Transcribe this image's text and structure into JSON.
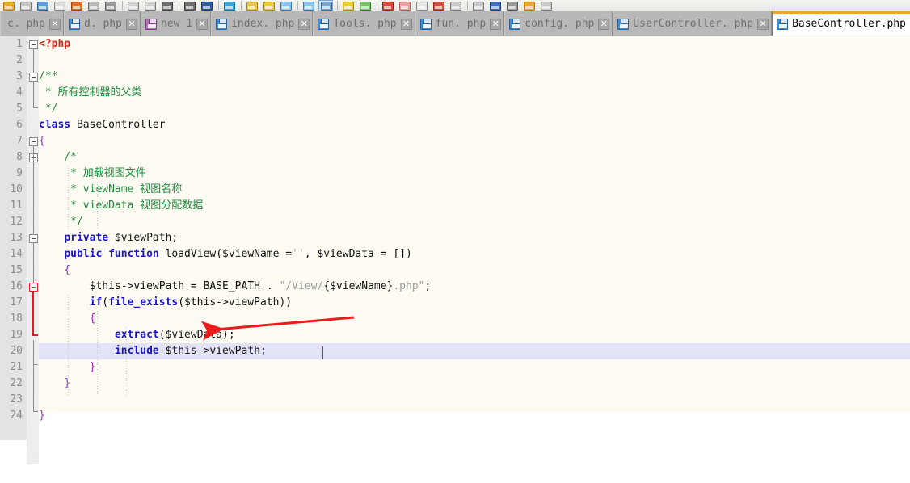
{
  "window": {
    "app": "code-editor",
    "active_file": "BaseController.php"
  },
  "toolbar": {
    "icons": [
      "open-folder-icon",
      "save-icon",
      "save-all-icon",
      "print-preview-icon",
      "close-icon",
      "print-icon",
      "cut-icon",
      "copy-icon",
      "paste-icon",
      "undo-icon",
      "redo-icon",
      "find-icon",
      "replace-icon",
      "zoom-in-icon",
      "zoom-out-icon",
      "bookmark-icon",
      "bookmark-next-icon",
      "indent-icon",
      "wrap-icon",
      "format-icon",
      "tag-icon",
      "map-icon",
      "brush-icon",
      "stop-icon",
      "browser-icon",
      "record-icon",
      "panel-icon",
      "f-icon",
      "ftp-icon",
      "window-icon"
    ]
  },
  "tabs": [
    {
      "label": "c. php",
      "icon": "floppy-icon",
      "state": "saved",
      "active": false,
      "truncated": true
    },
    {
      "label": "d. php",
      "icon": "floppy-icon",
      "state": "saved",
      "active": false,
      "truncated": false
    },
    {
      "label": "new 1",
      "icon": "floppy-unsaved-icon",
      "state": "unsaved",
      "active": false,
      "truncated": false
    },
    {
      "label": "index. php",
      "icon": "floppy-icon",
      "state": "saved",
      "active": false,
      "truncated": false
    },
    {
      "label": "Tools. php",
      "icon": "floppy-icon",
      "state": "saved",
      "active": false,
      "truncated": false
    },
    {
      "label": "fun. php",
      "icon": "floppy-icon",
      "state": "saved",
      "active": false,
      "truncated": false
    },
    {
      "label": "config. php",
      "icon": "floppy-icon",
      "state": "saved",
      "active": false,
      "truncated": false
    },
    {
      "label": "UserController. php",
      "icon": "floppy-icon",
      "state": "saved",
      "active": false,
      "truncated": false
    },
    {
      "label": "BaseController.php",
      "icon": "floppy-icon",
      "state": "saved",
      "active": true,
      "truncated": false
    }
  ],
  "tab_close_label": "✕",
  "editor": {
    "language": "php",
    "current_line": 20,
    "caret_after_text": "viewPath",
    "total_lines": 24,
    "lines": [
      {
        "n": "1",
        "text": "<?php"
      },
      {
        "n": "2",
        "text": ""
      },
      {
        "n": "3",
        "text": "/**"
      },
      {
        "n": "4",
        "text": " * 所有控制器的父类"
      },
      {
        "n": "5",
        "text": " */"
      },
      {
        "n": "6",
        "text": "class BaseController"
      },
      {
        "n": "7",
        "text": "{"
      },
      {
        "n": "8",
        "text": "    /*"
      },
      {
        "n": "9",
        "text": "     * 加载视图文件"
      },
      {
        "n": "10",
        "text": "     * viewName 视图名称"
      },
      {
        "n": "11",
        "text": "     * viewData 视图分配数据"
      },
      {
        "n": "12",
        "text": "     */"
      },
      {
        "n": "13",
        "text": "    private $viewPath;"
      },
      {
        "n": "14",
        "text": "    public function loadView($viewName ='', $viewData = [])"
      },
      {
        "n": "15",
        "text": "    {"
      },
      {
        "n": "16",
        "text": "        $this->viewPath = BASE_PATH . \"/View/{$viewName}.php\";"
      },
      {
        "n": "17",
        "text": "        if(file_exists($this->viewPath))"
      },
      {
        "n": "18",
        "text": "        {"
      },
      {
        "n": "19",
        "text": "            extract($viewData);"
      },
      {
        "n": "20",
        "text": "            include $this->viewPath;"
      },
      {
        "n": "21",
        "text": "        }"
      },
      {
        "n": "22",
        "text": "    }"
      },
      {
        "n": "23",
        "text": ""
      },
      {
        "n": "24",
        "text": "}"
      }
    ]
  },
  "annotation": {
    "type": "arrow",
    "color": "#ee1a1a",
    "points_to_line": 19,
    "points_to_text": "extract($viewData);"
  },
  "colors": {
    "accent_active_tab": "#f3a22a",
    "editor_background": "#fdfbf2",
    "current_line_highlight": "#e3e3f8",
    "gutter_background": "#e3e3e3",
    "tabbar_background": "#b8b8b8",
    "comment": "#1c8a3c",
    "keyword": "#1a14c8",
    "php_tag": "#d4261a",
    "brace": "#9a2ecb",
    "string": "#9a9a9a",
    "fold_active": "#e02020"
  }
}
